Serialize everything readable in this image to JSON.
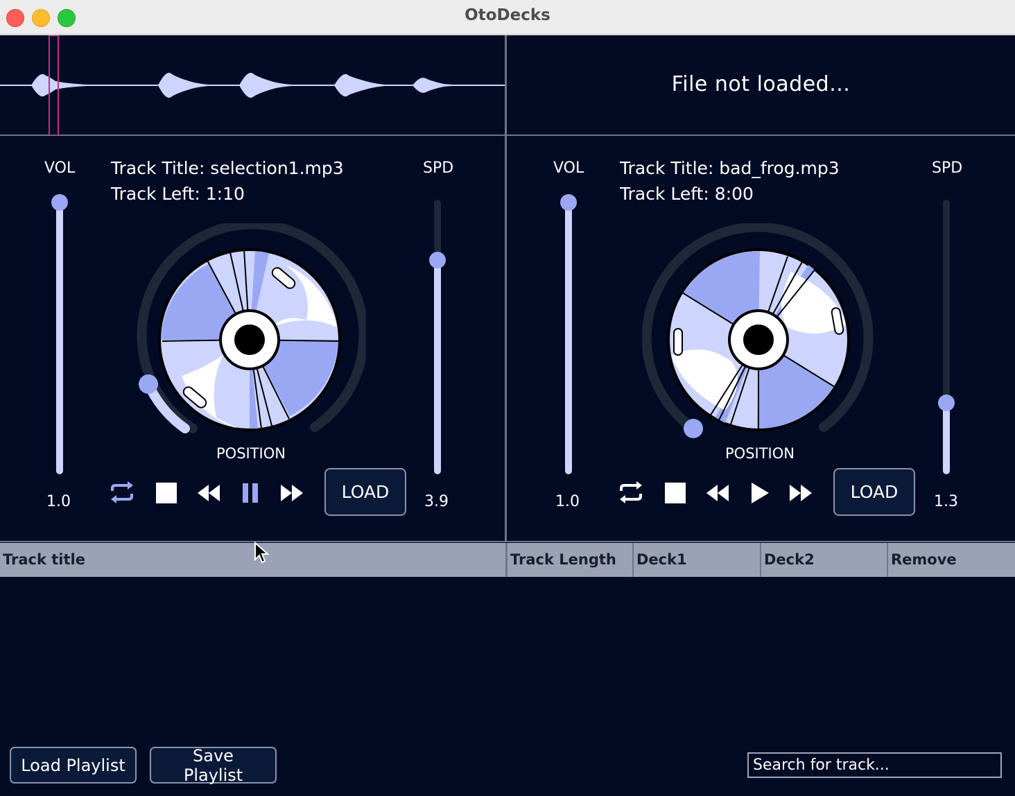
{
  "window": {
    "title": "OtoDecks"
  },
  "deck1": {
    "waveform_status": "",
    "vol_label": "VOL",
    "vol_value": "1.0",
    "spd_label": "SPD",
    "spd_value": "3.9",
    "track_title": "Track Title: selection1.mp3",
    "track_left": "Track Left: 1:10",
    "position_label": "POSITION",
    "load_label": "LOAD",
    "play_state": "playing",
    "vol_level": 1.0,
    "spd_level": 0.78,
    "position_level": 0.12
  },
  "deck2": {
    "waveform_status": "File not loaded...",
    "vol_label": "VOL",
    "vol_value": "1.0",
    "spd_label": "SPD",
    "spd_value": "1.3",
    "track_title": "Track Title: bad_frog.mp3",
    "track_left": "Track Left: 8:00",
    "position_label": "POSITION",
    "load_label": "LOAD",
    "play_state": "stopped",
    "vol_level": 1.0,
    "spd_level": 0.26,
    "position_level": 0.0
  },
  "playlist": {
    "columns": [
      "Track title",
      "Track Length",
      "Deck1",
      "Deck2",
      "Remove"
    ],
    "rows": [],
    "load_label": "Load Playlist",
    "save_label": "Save Playlist",
    "search_placeholder": "Search for track..."
  },
  "colors": {
    "background": "#030b24",
    "accent": "#9aa8f4",
    "accent_light": "#cdd5ff",
    "playhead": "#c0307a",
    "header": "#9ba2b6"
  }
}
